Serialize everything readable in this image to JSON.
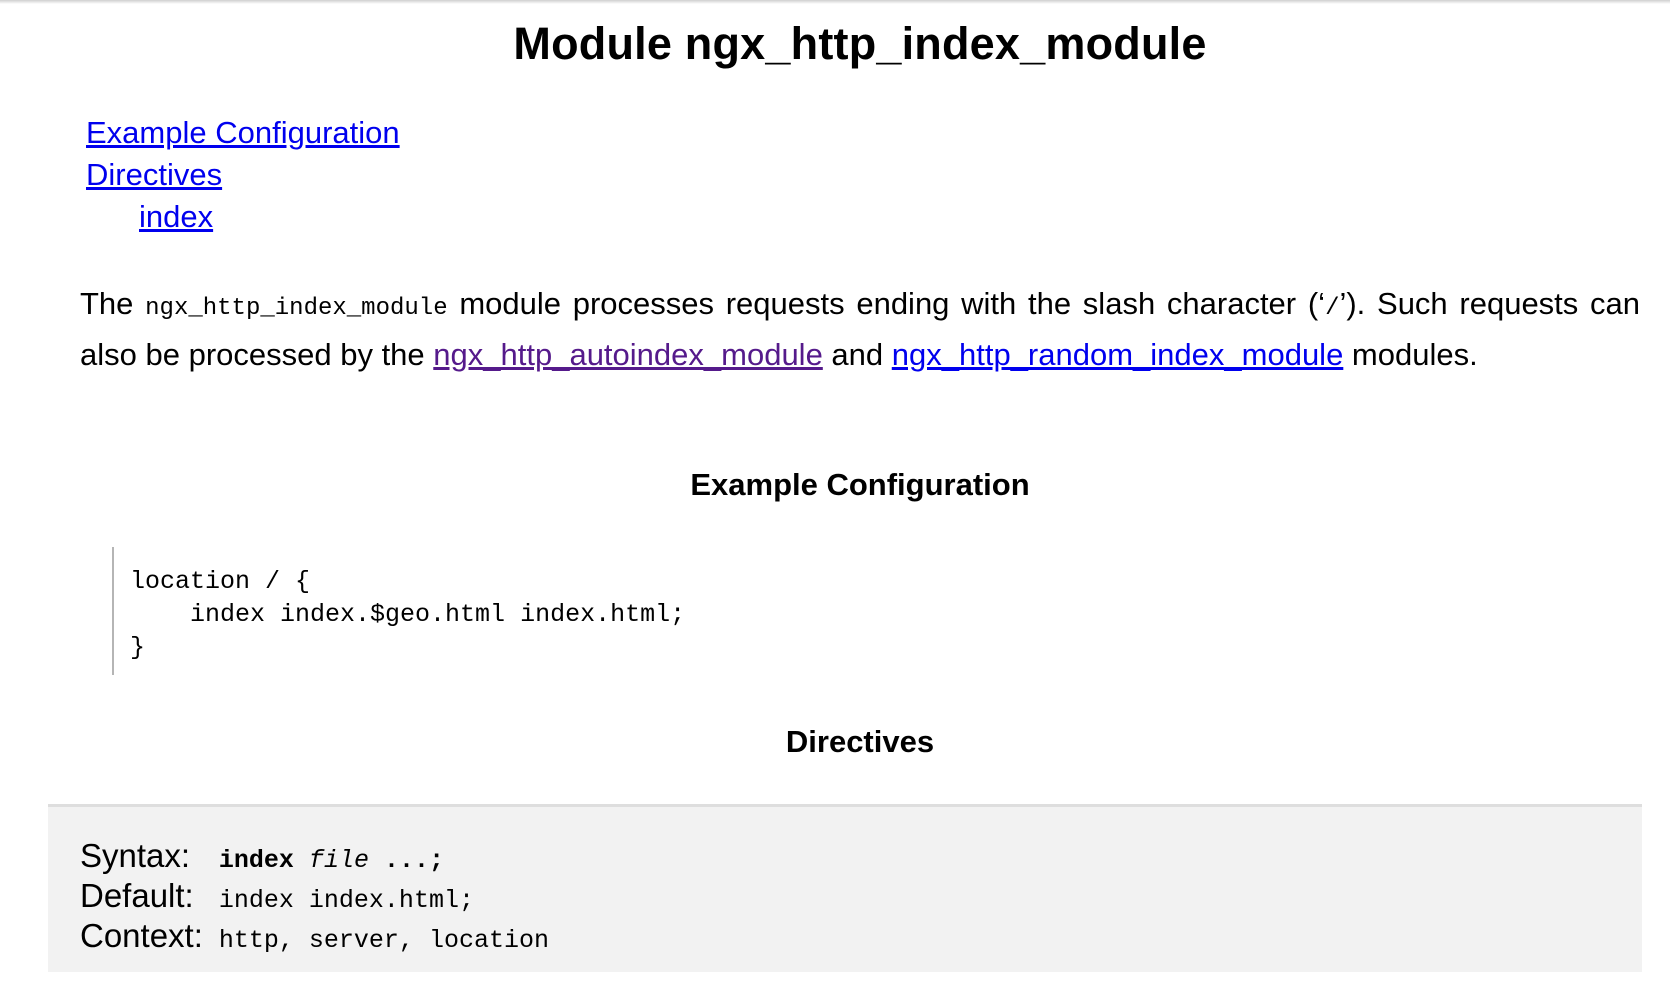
{
  "page": {
    "title": "Module ngx_http_index_module"
  },
  "toc": {
    "items": [
      {
        "label": "Example Configuration"
      },
      {
        "label": "Directives"
      },
      {
        "label": "index"
      }
    ]
  },
  "intro": {
    "part1": "The ",
    "module_code": "ngx_http_index_module",
    "part2": " module processes requests ending with the slash character (‘",
    "slash_code": "/",
    "part3": "’). Such requests can also be processed by the ",
    "link1": "ngx_http_autoindex_module",
    "part4": " and ",
    "link2": "ngx_http_random_index_module",
    "part5": " modules."
  },
  "sections": {
    "example_heading": "Example Configuration",
    "directives_heading": "Directives"
  },
  "example": {
    "code": "location / {\n    index index.$geo.html index.html;\n}"
  },
  "directive": {
    "syntax_label": "Syntax:",
    "syntax_name": "index",
    "syntax_param": "file",
    "syntax_rest": " ...;",
    "default_label": "Default:",
    "default_value": "index index.html;",
    "context_label": "Context:",
    "context_value": "http, server, location"
  },
  "colors": {
    "link": "#0000ee",
    "visited_link": "#551a8b",
    "directive_background": "#f2f2f2"
  }
}
